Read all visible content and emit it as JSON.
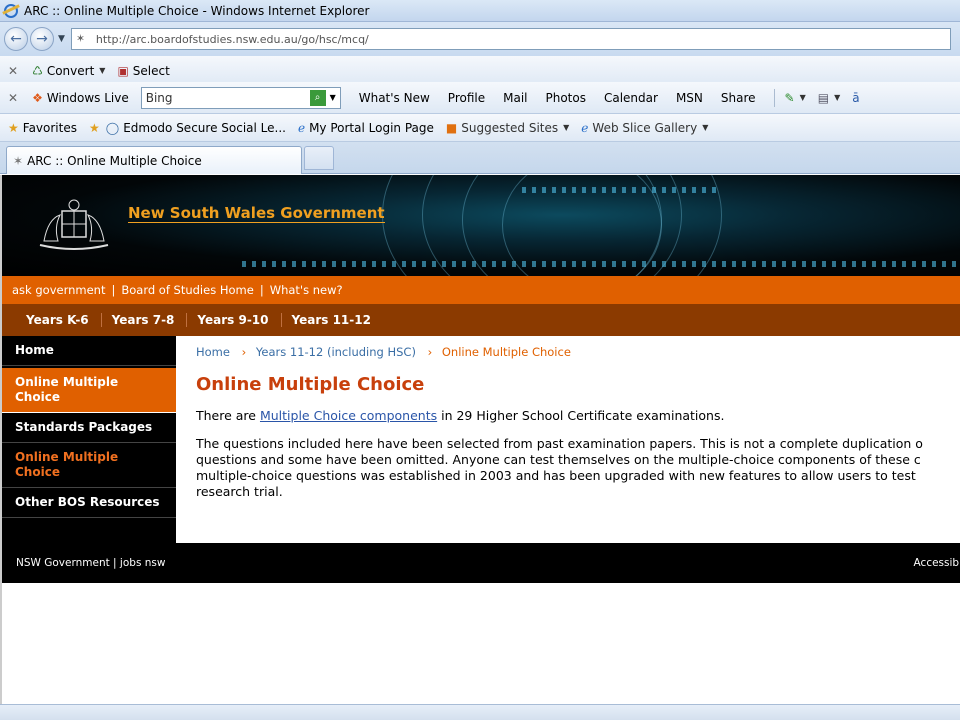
{
  "window": {
    "title": "ARC :: Online Multiple Choice - Windows Internet Explorer"
  },
  "address": {
    "url": "http://arc.boardofstudies.nsw.edu.au/go/hsc/mcq/"
  },
  "toolbar_convert": {
    "convert_label": "Convert",
    "select_label": "Select"
  },
  "toolbar_live": {
    "brand": "Windows Live",
    "search_value": "Bing",
    "links": [
      "What's New",
      "Profile",
      "Mail",
      "Photos",
      "Calendar",
      "MSN",
      "Share"
    ]
  },
  "favorites_bar": {
    "favorites_label": "Favorites",
    "items": [
      "Edmodo  Secure Social Le...",
      "My Portal Login Page",
      "Suggested Sites",
      "Web Slice Gallery"
    ]
  },
  "tabs": {
    "active_label": "ARC :: Online Multiple Choice"
  },
  "banner": {
    "title": "New South Wales Government"
  },
  "orange_bar": {
    "links": [
      "ask government",
      "Board of Studies Home",
      "What's new?"
    ]
  },
  "years_nav": {
    "items": [
      "Years K-6",
      "Years 7-8",
      "Years 9-10",
      "Years 11-12"
    ]
  },
  "left_nav": {
    "items": [
      "Home",
      "Online Multiple Choice",
      "Standards Packages",
      "Online Multiple Choice",
      "Other BOS Resources"
    ]
  },
  "breadcrumb": {
    "items": [
      "Home",
      "Years 11-12 (including HSC)",
      "Online Multiple Choice"
    ]
  },
  "content": {
    "title": "Online Multiple Choice",
    "intro_before": "There are ",
    "intro_link": "Multiple Choice components",
    "intro_after": " in 29 Higher School Certificate examinations.",
    "desc_lines": [
      "The questions included here have been selected from past examination papers. This is not a complete duplication o",
      "questions and some have been omitted. Anyone can test themselves on the multiple-choice components of these c",
      "multiple-choice questions was established in 2003 and has been upgraded with new features to allow users to test",
      "research trial."
    ]
  },
  "footer": {
    "left": "NSW Government | jobs nsw",
    "right": "Accessibi"
  },
  "colors": {
    "orange": "#e06000",
    "dark_orange": "#8b3a00",
    "title_orange": "#c8400c",
    "link_blue": "#2a55a8"
  }
}
